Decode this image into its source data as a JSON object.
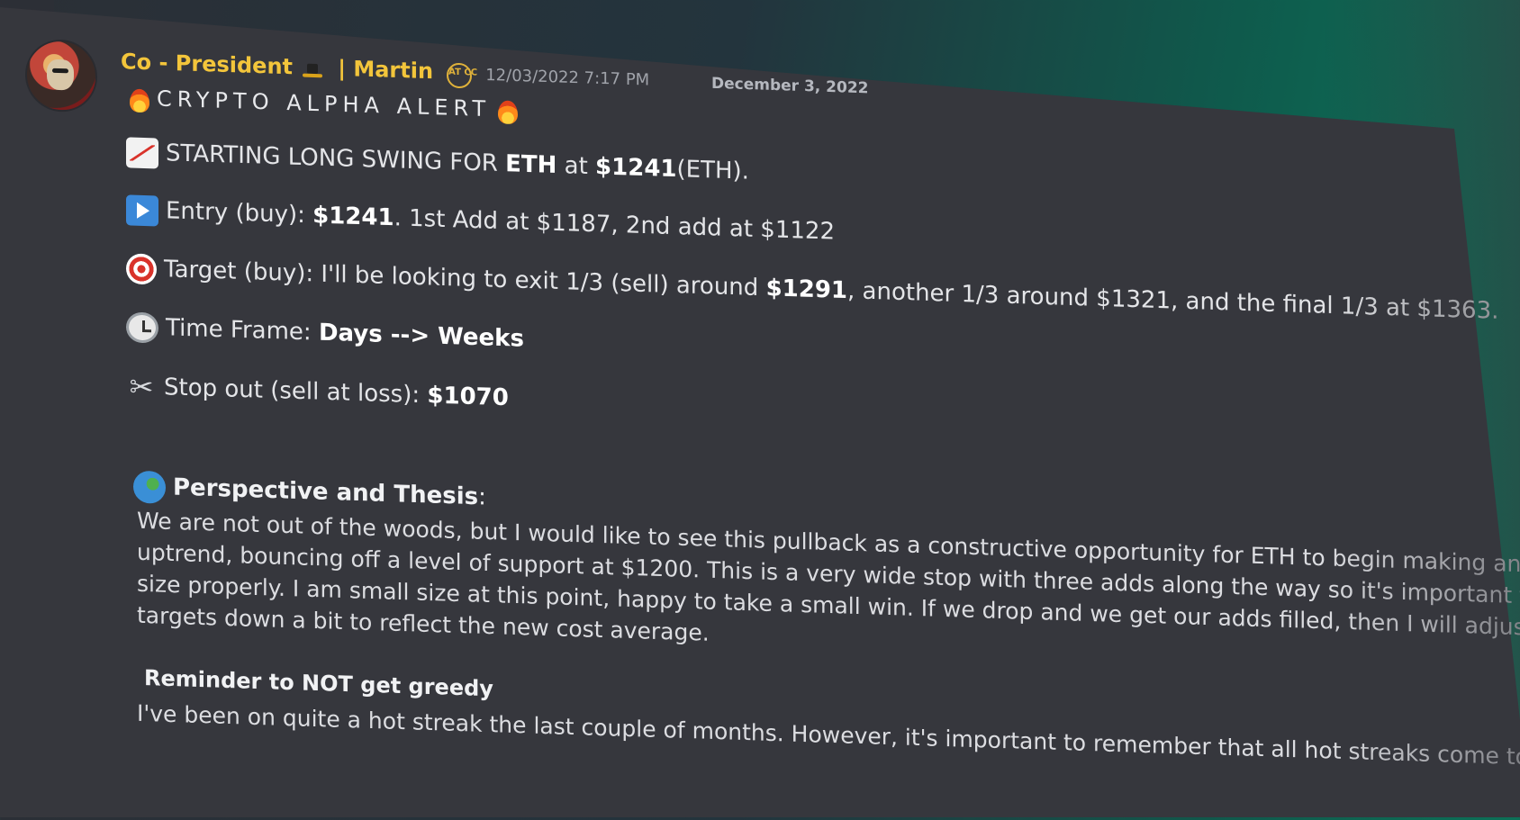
{
  "message": {
    "author": "Co - President",
    "author_suffix": "| Martin",
    "badge": "AT CC",
    "timestamp": "12/03/2022 7:17 PM",
    "date_separator": "December 3, 2022",
    "alert_title": "CRYPTO ALPHA ALERT",
    "lines": [
      {
        "icon": "chart-increasing-icon",
        "pre": "STARTING LONG SWING FOR ",
        "b1": "ETH",
        "mid": " at ",
        "b2": "$1241",
        "post": "(ETH)."
      },
      {
        "icon": "play-button-icon",
        "pre": "Entry (buy): ",
        "b1": "$1241",
        "post": ". 1st Add at $1187, 2nd add at $1122"
      },
      {
        "icon": "direct-hit-target-icon",
        "pre": "Target (buy): I'll be looking to exit 1/3 (sell) around ",
        "b1": "$1291",
        "post": ", another 1/3 around $1321, and the final 1/3 at $1363."
      },
      {
        "icon": "timer-clock-icon",
        "pre": "Time Frame: ",
        "b1": "Days --> Weeks"
      },
      {
        "icon": "scissors-icon",
        "pre": "Stop out (sell at loss): ",
        "b1": "$1070"
      }
    ],
    "thesis_heading": "Perspective and Thesis",
    "thesis_colon": ":",
    "thesis_lines": [
      "We are not out of the woods, but I would like to see this pullback as a constructive opportunity for ETH to begin making an",
      "uptrend, bouncing off a level of support at $1200.  This is a very wide stop with three adds along the way so it's important to",
      "size properly. I am small size at this point, happy to take a small win.  If we drop and we get our adds filled, then I will adjust the",
      "targets down a bit to reflect the new cost average."
    ],
    "reminder_heading": "Reminder to NOT get greedy",
    "reminder_text": "I've been on quite a hot streak the last couple of months.  However, it's important to remember that all hot streaks come to an"
  }
}
